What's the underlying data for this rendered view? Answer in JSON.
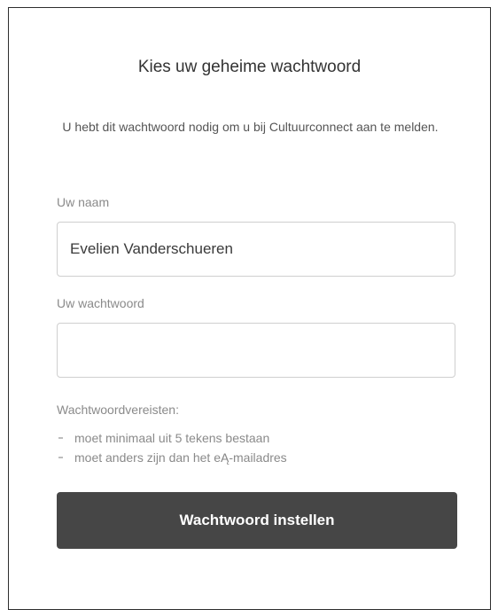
{
  "form": {
    "title": "Kies uw geheime wachtwoord",
    "intro": "U hebt dit wachtwoord nodig om u bij Cultuurconnect aan te melden.",
    "name_label": "Uw naam",
    "name_value": "Evelien Vanderschueren",
    "password_label": "Uw wachtwoord",
    "password_value": "",
    "requirements_heading": "Wachtwoordvereisten:",
    "requirements": [
      "moet minimaal uit 5 tekens bestaan",
      "moet anders zijn dan het eĄ-mailadres"
    ],
    "submit_label": "Wachtwoord instellen"
  },
  "colors": {
    "button_bg": "#464646",
    "button_text": "#ffffff",
    "label_text": "#8a8a8a",
    "title_text": "#333333"
  }
}
